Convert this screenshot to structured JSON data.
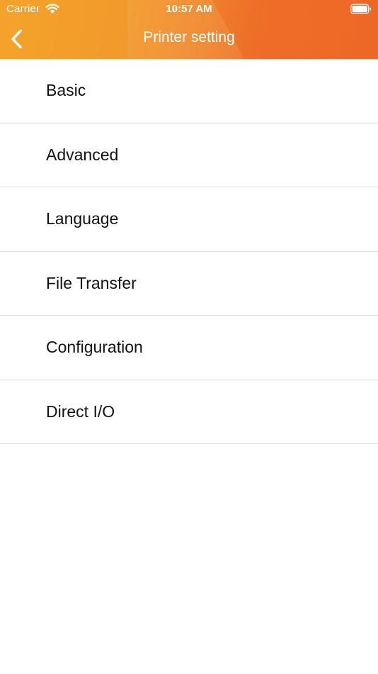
{
  "status_bar": {
    "carrier": "Carrier",
    "time": "10:57 AM",
    "wifi_icon": "wifi-icon",
    "battery_icon": "battery-icon"
  },
  "nav_bar": {
    "title": "Printer setting",
    "back_icon": "chevron-left-icon"
  },
  "menu": {
    "items": [
      {
        "label": "Basic"
      },
      {
        "label": "Advanced"
      },
      {
        "label": "Language"
      },
      {
        "label": "File Transfer"
      },
      {
        "label": "Configuration"
      },
      {
        "label": "Direct I/O"
      }
    ]
  },
  "colors": {
    "header_start": "#f4a32a",
    "header_end": "#ee6a28",
    "text": "#111111",
    "separator": "#dcdcdc"
  }
}
